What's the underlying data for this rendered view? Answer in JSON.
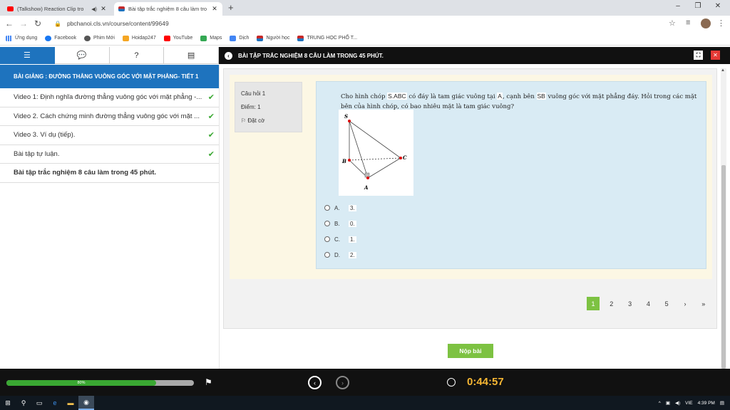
{
  "browser": {
    "tabs": [
      {
        "title": "(Talkshow) Reaction Clip tro",
        "active": false
      },
      {
        "title": "Bài tập trắc nghiệm 8 câu làm tro",
        "active": true
      }
    ],
    "url": "pbchanoi.cls.vn/course/content/99649",
    "bookmarks": [
      {
        "label": "Ứng dụng",
        "color": "#666666"
      },
      {
        "label": "Facebook",
        "color": "#1877f2"
      },
      {
        "label": "Phim Mới",
        "color": "#555555"
      },
      {
        "label": "Hoidap247",
        "color": "#f5a623"
      },
      {
        "label": "YouTube",
        "color": "#ff0000"
      },
      {
        "label": "Maps",
        "color": "#34a853"
      },
      {
        "label": "Dịch",
        "color": "#4285f4"
      },
      {
        "label": "Người học",
        "color": "#c62828"
      },
      {
        "label": "TRUNG HỌC PHỔ T...",
        "color": "#c62828"
      }
    ]
  },
  "sidebar": {
    "lesson_title": "BÀI GIẢNG : ĐƯỜNG THẲNG VUÔNG GÓC VỚI MẶT PHẲNG- TIẾT 1",
    "items": [
      {
        "label": "Video 1: Định nghĩa đường thẳng vuông góc với mặt phẳng -...",
        "done": true
      },
      {
        "label": "Video 2. Cách chứng minh đường thẳng vuông góc với mặt ...",
        "done": true
      },
      {
        "label": "Video 3. Ví dụ (tiếp).",
        "done": true
      },
      {
        "label": "Bài tập tự luận.",
        "done": true
      },
      {
        "label": "Bài tập trắc nghiệm 8 câu làm trong 45 phút.",
        "done": false
      }
    ]
  },
  "header": {
    "title": "BÀI TẬP TRẮC NGHIỆM 8 CÂU LÀM TRONG 45 PHÚT."
  },
  "question": {
    "number_label": "Câu hỏi 1",
    "score_label": "Điểm: 1",
    "flag_label": "Đặt cờ",
    "text_1": "Cho hình chóp ",
    "text_hl1": "S.ABC",
    "text_2": " có đáy là tam giác vuông tại ",
    "text_hl2": "A",
    "text_3": ", cạnh bên ",
    "text_hl3": "SB",
    "text_4": " vuông góc với mặt phẳng đáy. Hỏi trong các mặt bên của hình chóp, có bao nhiêu mặt là tam giác vuông?",
    "figure_labels": {
      "s": "S",
      "b": "B",
      "c": "C",
      "a": "A"
    },
    "options": [
      {
        "letter": "A.",
        "value": "3."
      },
      {
        "letter": "B.",
        "value": "0."
      },
      {
        "letter": "C.",
        "value": "1."
      },
      {
        "letter": "D.",
        "value": "2."
      }
    ]
  },
  "pager": {
    "pages": [
      "1",
      "2",
      "3",
      "4",
      "5",
      "›",
      "»"
    ],
    "active": "1"
  },
  "submit_label": "Nộp bài",
  "player": {
    "progress_label": "80%",
    "progress": 0.8,
    "timer": "0:44:57"
  },
  "taskbar": {
    "lang": "VIE",
    "time": "4:39 PM"
  },
  "colors": {
    "primary_blue": "#1e73be",
    "green": "#7dc242",
    "timer_yellow": "#f7b733"
  }
}
